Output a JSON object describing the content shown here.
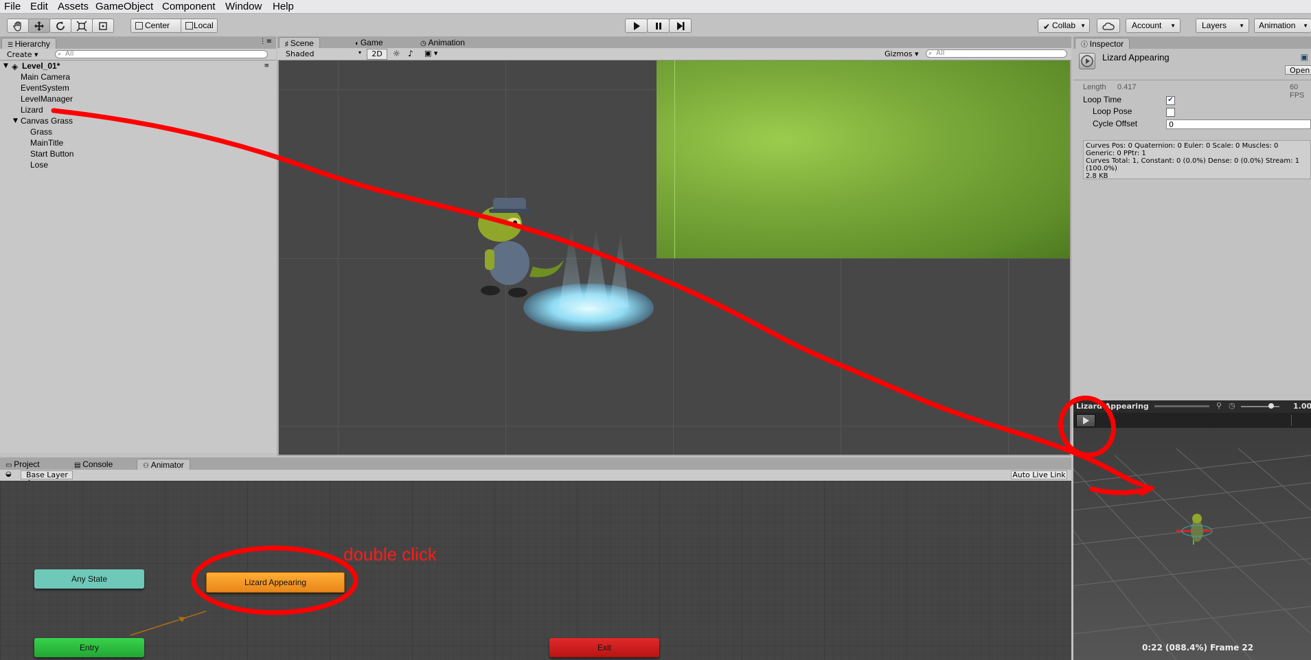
{
  "menu": [
    "File",
    "Edit",
    "Assets",
    "GameObject",
    "Component",
    "Window",
    "Help"
  ],
  "toolbar": {
    "pivot": "Center",
    "space": "Local",
    "collab": "Collab",
    "account": "Account",
    "layers": "Layers",
    "layout": "Animation"
  },
  "hierarchy": {
    "tab": "Hierarchy",
    "create": "Create",
    "search_placeholder": "All",
    "scene_name": "Level_01*",
    "items": [
      "Main Camera",
      "EventSystem",
      "LevelManager",
      "Lizard",
      "Canvas Grass",
      "Grass",
      "MainTitle",
      "Start Button",
      "Lose"
    ]
  },
  "scene_tabs": {
    "scene": "Scene",
    "game": "Game",
    "animation": "Animation",
    "shading": "Shaded",
    "mode_2d": "2D",
    "gizmos": "Gizmos",
    "search_placeholder": "All"
  },
  "bottom_tabs": {
    "project": "Project",
    "console": "Console",
    "animator": "Animator",
    "layer": "Base Layer",
    "auto_live_link": "Auto Live Link"
  },
  "animator": {
    "any_state": "Any State",
    "entry": "Entry",
    "exit": "Exit",
    "state": "Lizard Appearing",
    "annotation": "double click"
  },
  "inspector": {
    "tab": "Inspector",
    "clip_name": "Lizard Appearing",
    "open": "Open",
    "length_label": "Length",
    "length_value": "0.417",
    "fps": "60 FPS",
    "loop_time": "Loop Time",
    "loop_time_checked": true,
    "loop_pose": "Loop Pose",
    "loop_pose_checked": false,
    "cycle_offset": "Cycle Offset",
    "cycle_offset_value": "0",
    "info_lines": [
      "Curves Pos: 0 Quaternion: 0 Euler: 0 Scale: 0 Muscles: 0",
      "Generic: 0 PPtr: 1",
      "Curves Total: 1, Constant: 0 (0.0%) Dense: 0 (0.0%) Stream: 1",
      "(100.0%)",
      "2.8 KB"
    ]
  },
  "preview": {
    "title": "Lizard Appearing",
    "speed": "1.00",
    "status": "0:22 (088.4%) Frame 22"
  },
  "colors": {
    "any_state": "#6fc9b8",
    "entry": "#27b83a",
    "exit": "#d01c1c",
    "state": "#f0921a",
    "annotation": "#ff1a1a"
  }
}
